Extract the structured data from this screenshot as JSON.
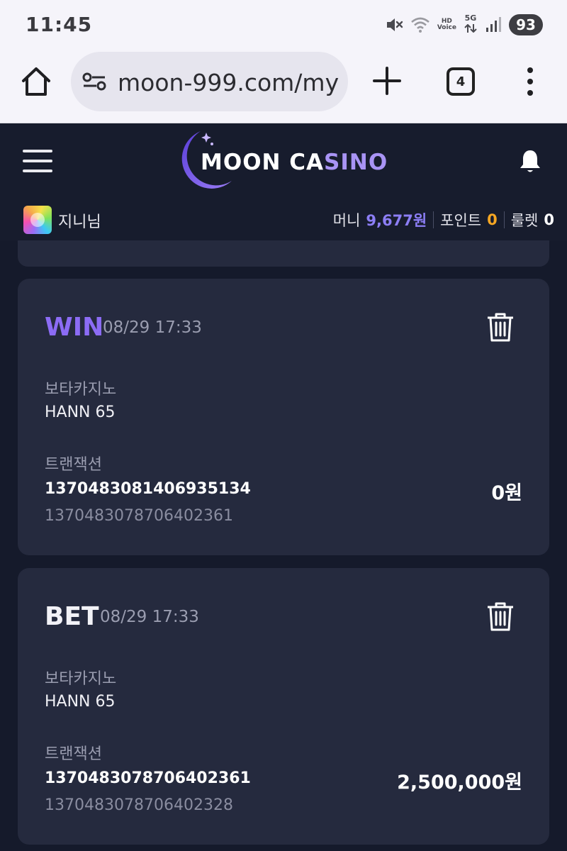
{
  "status_bar": {
    "time": "11:45",
    "hd_line1": "HD",
    "hd_line2": "Voice",
    "network": "5G",
    "battery": "93",
    "icons": [
      "mute-icon",
      "wifi-icon",
      "hd-voice-icon",
      "5g-icon",
      "signal-icon",
      "battery-icon"
    ]
  },
  "browser": {
    "url": "moon-999.com/my",
    "tab_count": "4",
    "icons": [
      "home-icon",
      "site-settings-icon",
      "plus-icon",
      "tabs-icon",
      "more-icon"
    ]
  },
  "app": {
    "logo_part1": "MOON CA",
    "logo_part2": "SINO",
    "logo_colors": {
      "moon": "#7b5cf0",
      "accent": "#a994f5"
    },
    "user": {
      "name": "지니님"
    },
    "balances": {
      "money_label": "머니",
      "money_value": "9,677원",
      "point_label": "포인트",
      "point_value": "0",
      "roulette_label": "룰렛",
      "roulette_value": "0"
    },
    "colors": {
      "header_bg": "#171c2d",
      "card_bg": "#252a3e",
      "win": "#8c6cf5",
      "point": "#f5a623"
    }
  },
  "transactions": [
    {
      "type": "WIN",
      "date": "08/29 17:33",
      "provider": "보타카지노",
      "game": "HANN 65",
      "tx_label": "트랜잭션",
      "tx_id": "1370483081406935134",
      "ref_id": "1370483078706402361",
      "amount": "0원"
    },
    {
      "type": "BET",
      "date": "08/29 17:33",
      "provider": "보타카지노",
      "game": "HANN 65",
      "tx_label": "트랜잭션",
      "tx_id": "1370483078706402361",
      "ref_id": "1370483078706402328",
      "amount": "2,500,000원"
    }
  ]
}
